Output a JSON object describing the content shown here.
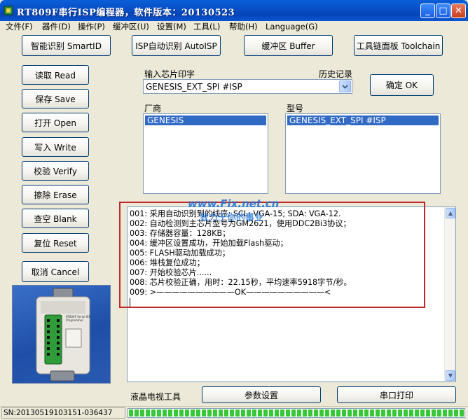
{
  "window": {
    "title": "RT809F串行ISP编程器，软件版本：20130523"
  },
  "menu": [
    "文件(F)",
    "器件(D)",
    "操作(P)",
    "缓冲区(U)",
    "设置(M)",
    "工具(L)",
    "帮助(H)",
    "Language(G)"
  ],
  "toolbar": {
    "smart_id": "智能识别 SmartID",
    "isp_auto": "ISP自动识别 AutoISP",
    "buffer": "缓冲区 Buffer",
    "toolchain": "工具链面板 Toolchain"
  },
  "actions": {
    "read": "读取 Read",
    "save": "保存 Save",
    "open": "打开 Open",
    "write": "写入 Write",
    "verify": "校验 Verify",
    "erase": "擦除 Erase",
    "blank": "查空 Blank",
    "reset": "复位 Reset",
    "cancel": "取消 Cancel"
  },
  "chip": {
    "input_label": "输入芯片印字",
    "history_label": "历史记录",
    "input_value": "GENESIS_EXT_SPI #ISP",
    "ok_button": "确定 OK",
    "vendor_label": "厂商",
    "model_label": "型号",
    "vendors": [
      "GENESIS"
    ],
    "models": [
      "GENESIS_EXT_SPI #ISP"
    ]
  },
  "log": [
    "001: 采用自动识别到的线序: SCL: VGA-15; SDA: VGA-12.",
    "002: 自动检测到主芯片型号为GM2621，使用DDC2Bi3协议；",
    "003: 存储器容量：128KB；",
    "004: 缓冲区设置成功，开始加载Flash驱动；",
    "005: FLASH驱动加载成功；",
    "006: 堆栈复位成功；",
    "007: 开始校验芯片......",
    "008: 芯片校验正确，用时：22.15秒，平均速率5918字节/秒。",
    "009: >——————————OK——————————<"
  ],
  "watermark": {
    "line1": "www.Fix.net.cn",
    "line2": "致力于你的事业"
  },
  "bottom": {
    "lcd_tool": "液晶电视工具",
    "params": "参数设置",
    "serial_print": "串口打印"
  },
  "device_image": {
    "label_top": "RT809F Serial ISP Programmer"
  },
  "status": {
    "sn": "SN:20130519103151-036437",
    "progress": 1.0
  },
  "colors": {
    "title_bar": "#0a5fd8",
    "selection": "#316ac5",
    "highlight_box": "#c0282a",
    "progress": "#37c837",
    "watermark": "#1a6fd8"
  }
}
